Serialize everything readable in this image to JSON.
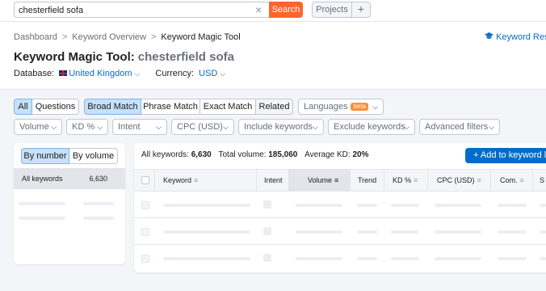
{
  "search": {
    "value": "chesterfield sofa",
    "button_label": "Search"
  },
  "topbar": {
    "projects_label": "Projects",
    "plus_label": "+"
  },
  "breadcrumb": [
    "Dashboard",
    "Keyword Overview",
    "Keyword Magic Tool"
  ],
  "header": {
    "link_label": "Keyword Rese",
    "title": "Keyword Magic Tool:",
    "query": "chesterfield sofa",
    "database_label": "Database:",
    "database_value": "United Kingdom",
    "currency_label": "Currency:",
    "currency_value": "USD"
  },
  "match_tabs": [
    "All",
    "Questions"
  ],
  "match_types": [
    "Broad Match",
    "Phrase Match",
    "Exact Match",
    "Related"
  ],
  "languages": {
    "label": "Languages",
    "badge": "beta"
  },
  "filters": [
    "Volume",
    "KD %",
    "Intent",
    "CPC (USD)",
    "Include keywords",
    "Exclude keywords",
    "Advanced filters"
  ],
  "group_toggle": [
    "By number",
    "By volume"
  ],
  "groups": [
    {
      "label": "All keywords",
      "count": "6,630"
    }
  ],
  "stats": {
    "all_keywords_label": "All keywords:",
    "all_keywords_value": "6,630",
    "total_volume_label": "Total volume:",
    "total_volume_value": "185,060",
    "avg_kd_label": "Average KD:",
    "avg_kd_value": "20%"
  },
  "add_button": "+ Add to keyword l",
  "table": {
    "columns": [
      "Keyword",
      "Intent",
      "Volume",
      "Trend",
      "KD %",
      "CPC (USD)",
      "Com.",
      "S"
    ]
  },
  "colors": {
    "accent": "#006dca",
    "search_button": "#ff642d",
    "selected_tab": "#c6e1f9"
  }
}
